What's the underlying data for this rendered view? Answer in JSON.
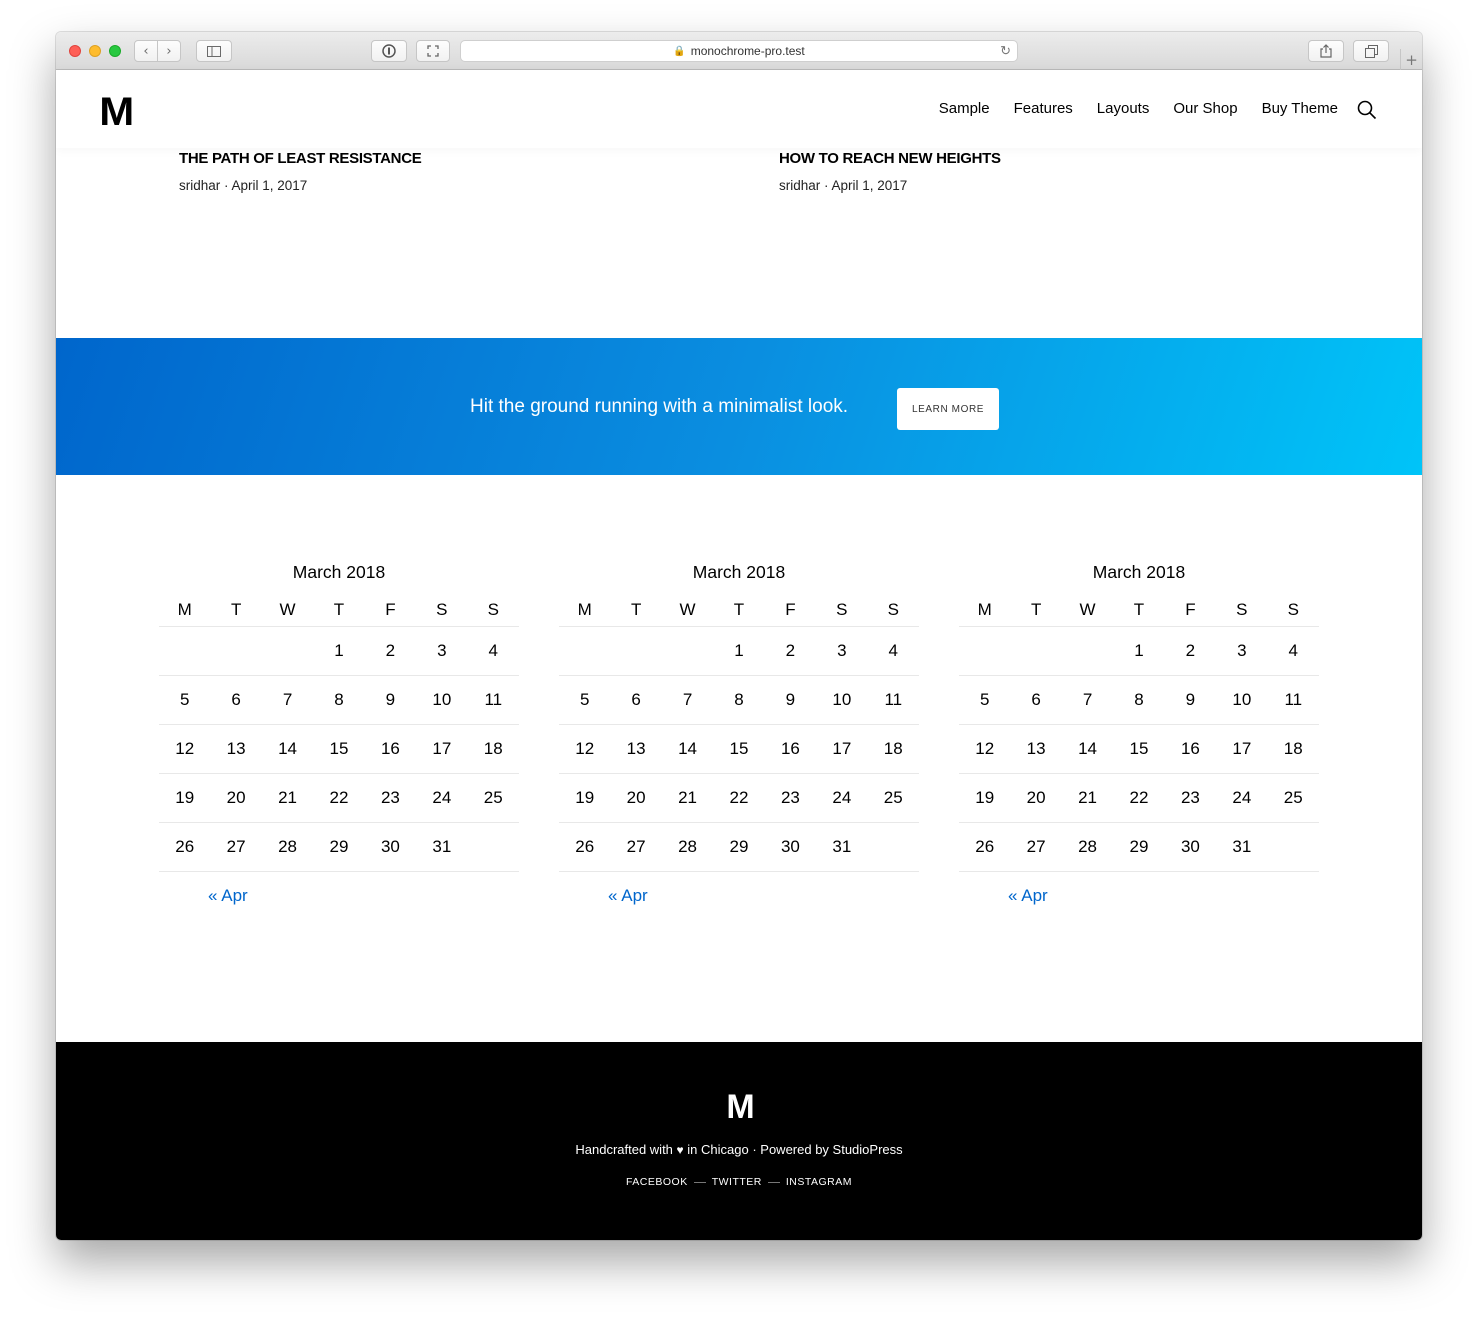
{
  "browser": {
    "url": "monochrome-pro.test",
    "icons": {
      "back": "chevron-left-icon",
      "forward": "chevron-right-icon",
      "sidebar": "sidebar-icon",
      "password": "password-manager-icon",
      "share": "share-icon",
      "tabs": "tabs-icon"
    }
  },
  "header": {
    "logo": "M",
    "nav": [
      "Sample",
      "Features",
      "Layouts",
      "Our Shop",
      "Buy Theme"
    ]
  },
  "posts": [
    {
      "title": "THE PATH OF LEAST RESISTANCE",
      "meta": "sridhar · April 1, 2017"
    },
    {
      "title": "HOW TO REACH NEW HEIGHTS",
      "meta": "sridhar · April 1, 2017"
    }
  ],
  "cta": {
    "text": "Hit the ground running with a minimalist look.",
    "button": "LEARN MORE",
    "colors": {
      "start": "#0066cc",
      "end": "#00c4f8"
    }
  },
  "calendars": [
    {
      "caption": "March 2018",
      "days": [
        "M",
        "T",
        "W",
        "T",
        "F",
        "S",
        "S"
      ],
      "weeks": [
        [
          "",
          "",
          "",
          "1",
          "2",
          "3",
          "4"
        ],
        [
          "5",
          "6",
          "7",
          "8",
          "9",
          "10",
          "11"
        ],
        [
          "12",
          "13",
          "14",
          "15",
          "16",
          "17",
          "18"
        ],
        [
          "19",
          "20",
          "21",
          "22",
          "23",
          "24",
          "25"
        ],
        [
          "26",
          "27",
          "28",
          "29",
          "30",
          "31",
          ""
        ]
      ],
      "prev": "« Apr"
    },
    {
      "caption": "March 2018",
      "days": [
        "M",
        "T",
        "W",
        "T",
        "F",
        "S",
        "S"
      ],
      "weeks": [
        [
          "",
          "",
          "",
          "1",
          "2",
          "3",
          "4"
        ],
        [
          "5",
          "6",
          "7",
          "8",
          "9",
          "10",
          "11"
        ],
        [
          "12",
          "13",
          "14",
          "15",
          "16",
          "17",
          "18"
        ],
        [
          "19",
          "20",
          "21",
          "22",
          "23",
          "24",
          "25"
        ],
        [
          "26",
          "27",
          "28",
          "29",
          "30",
          "31",
          ""
        ]
      ],
      "prev": "« Apr"
    },
    {
      "caption": "March 2018",
      "days": [
        "M",
        "T",
        "W",
        "T",
        "F",
        "S",
        "S"
      ],
      "weeks": [
        [
          "",
          "",
          "",
          "1",
          "2",
          "3",
          "4"
        ],
        [
          "5",
          "6",
          "7",
          "8",
          "9",
          "10",
          "11"
        ],
        [
          "12",
          "13",
          "14",
          "15",
          "16",
          "17",
          "18"
        ],
        [
          "19",
          "20",
          "21",
          "22",
          "23",
          "24",
          "25"
        ],
        [
          "26",
          "27",
          "28",
          "29",
          "30",
          "31",
          ""
        ]
      ],
      "prev": "« Apr"
    }
  ],
  "footer": {
    "logo": "M",
    "credit_before": "Handcrafted with",
    "credit_after": "in Chicago · Powered by StudioPress",
    "heart_icon": "heart-icon",
    "social": [
      "FACEBOOK",
      "TWITTER",
      "INSTAGRAM"
    ]
  },
  "colors": {
    "link": "#0066cc",
    "footer_bg": "#000000"
  }
}
